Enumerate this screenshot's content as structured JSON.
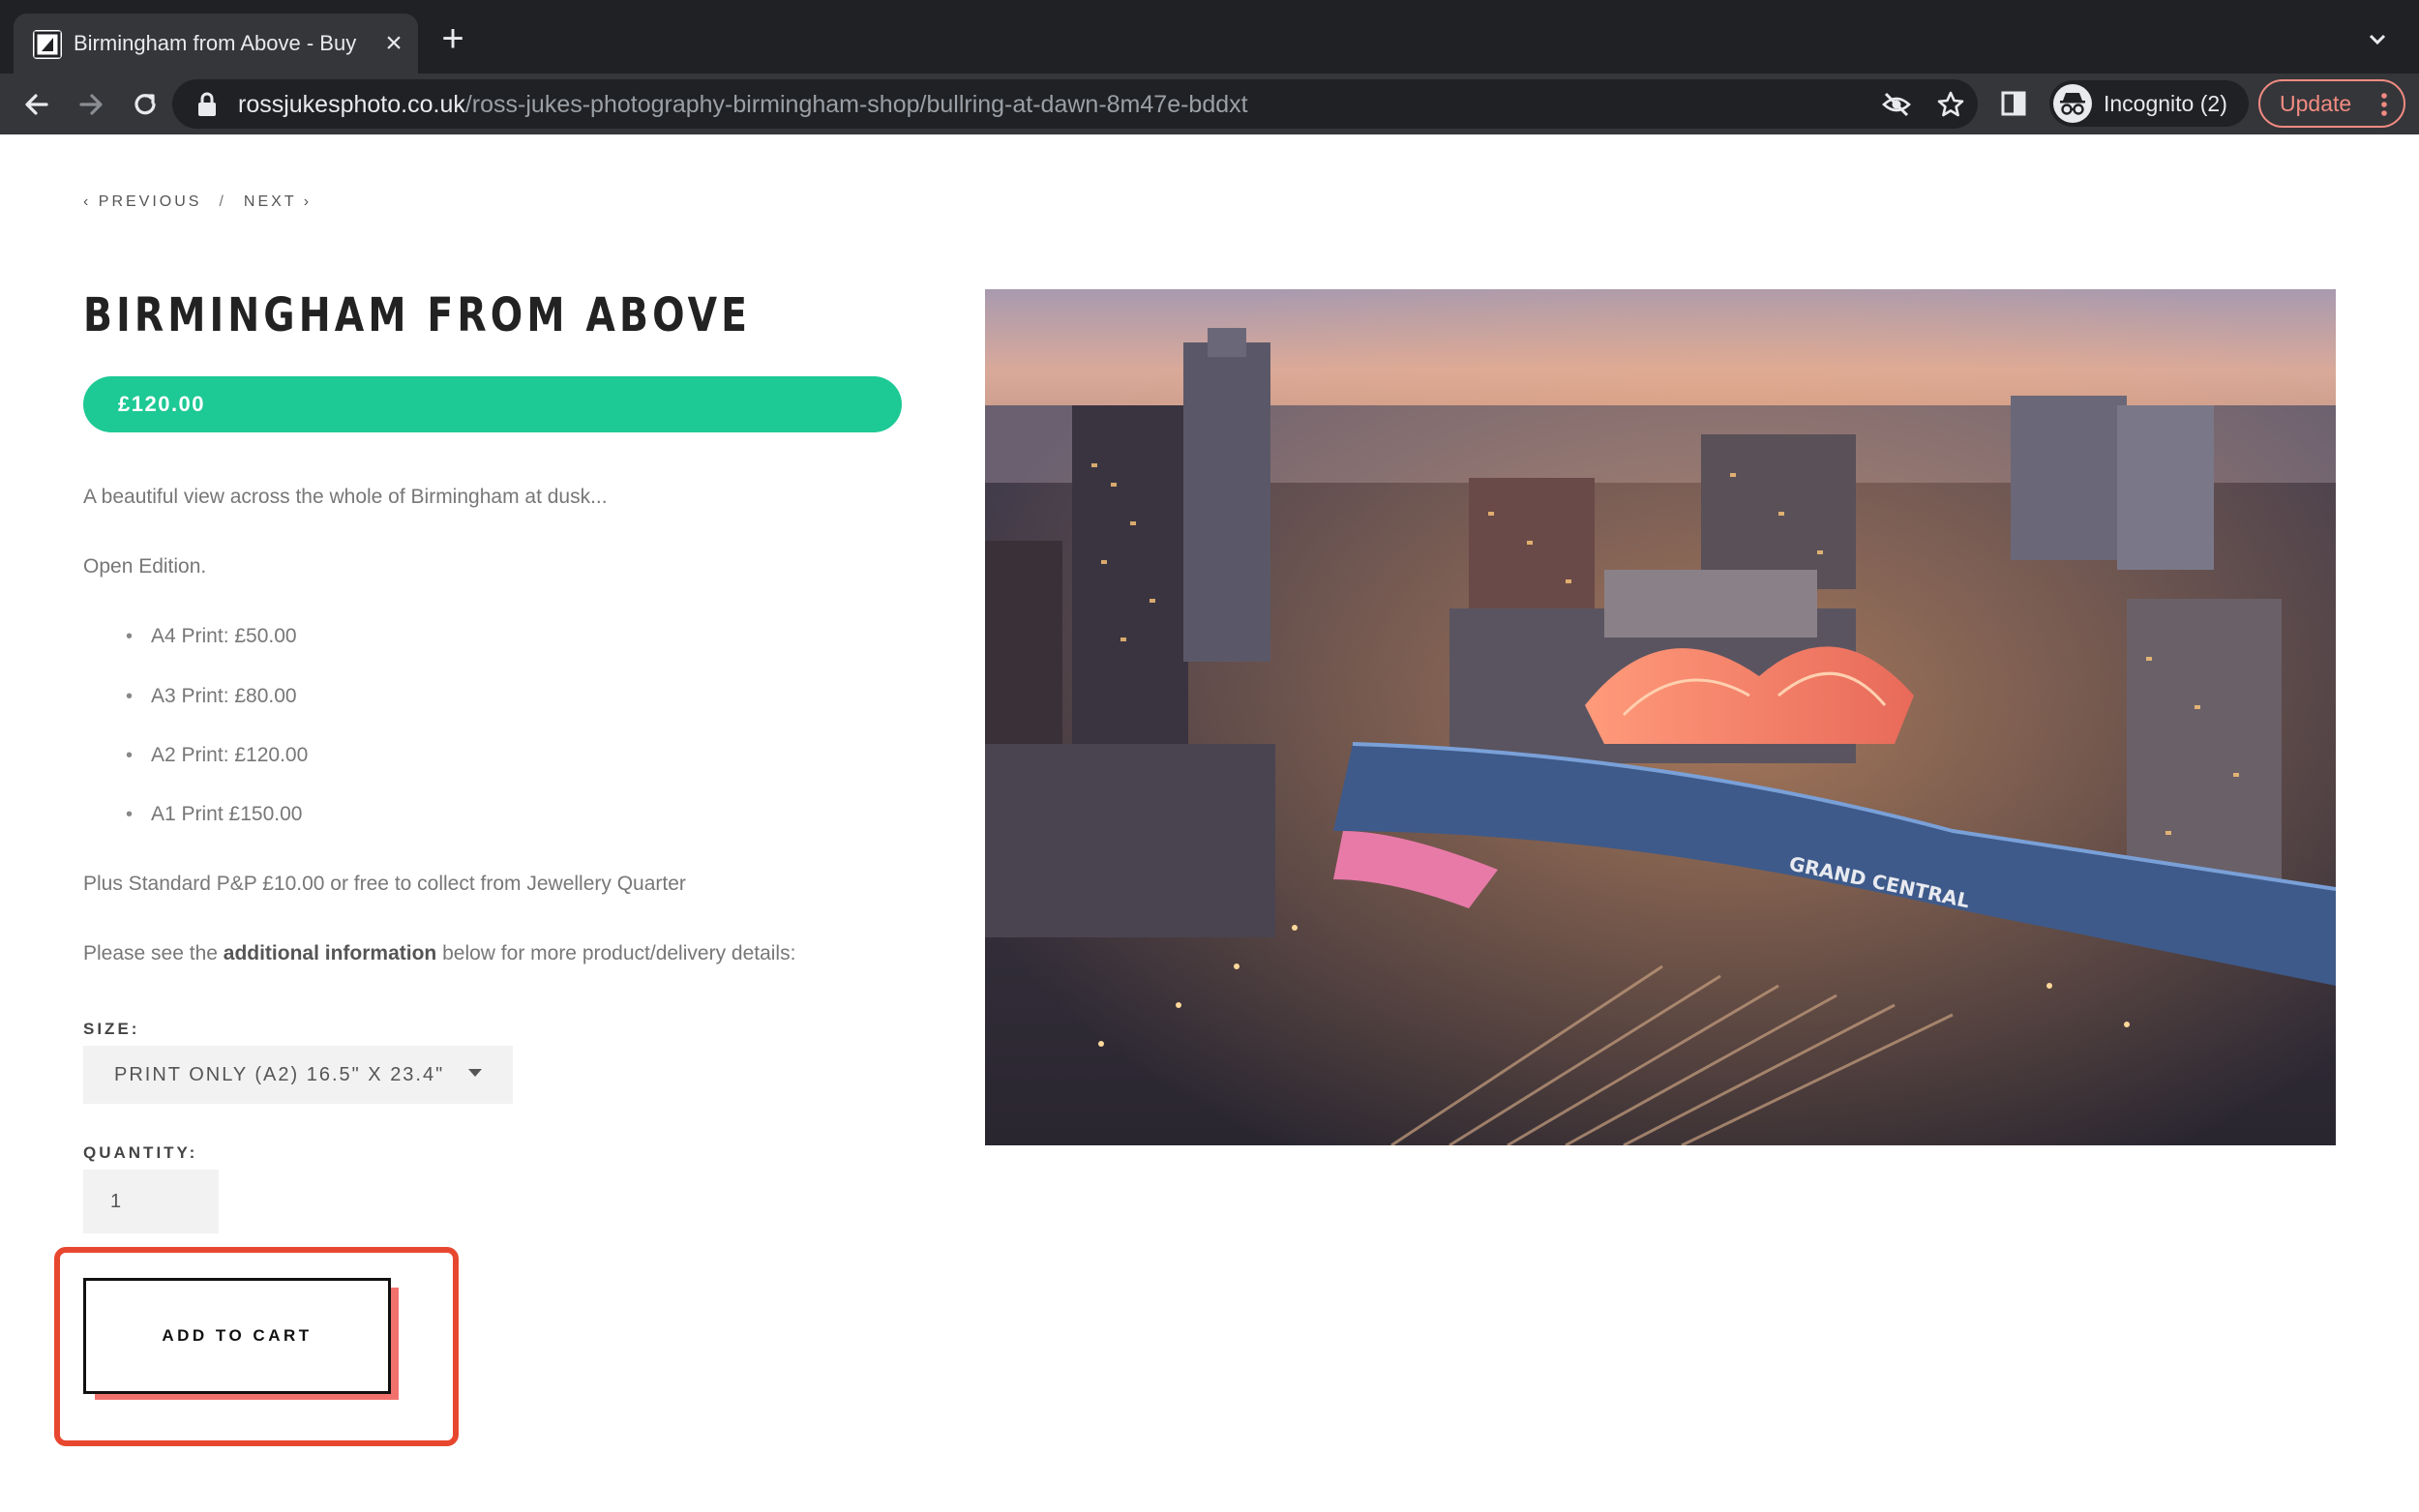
{
  "browser": {
    "tab": {
      "title": "Birmingham from Above - Buy",
      "close_icon": "close-icon",
      "favicon": "site-favicon"
    },
    "new_tab_icon": "plus-icon",
    "url": {
      "domain": "rossjukesphoto.co.uk",
      "path": "/ross-jukes-photography-birmingham-shop/bullring-at-dawn-8m47e-bddxt"
    },
    "incognito_label": "Incognito (2)",
    "update_label": "Update"
  },
  "pager": {
    "previous": "‹ PREVIOUS",
    "separator": "/",
    "next": "NEXT ›"
  },
  "product": {
    "title": "BIRMINGHAM FROM ABOVE",
    "price": "£120.00",
    "description": "A beautiful view across the whole of Birmingham at dusk...",
    "edition": "Open Edition.",
    "options": [
      "A4 Print: £50.00",
      "A3 Print: £80.00",
      "A2 Print: £120.00",
      "A1 Print £150.00"
    ],
    "shipping": "Plus Standard P&P £10.00 or free to collect from Jewellery Quarter",
    "info_prefix": "Please see the ",
    "info_bold": "additional information",
    "info_suffix": " below for more product/delivery details:"
  },
  "form": {
    "size_label": "SIZE:",
    "size_value": "PRINT ONLY (A2) 16.5\" X 23.4\"",
    "quantity_label": "QUANTITY:",
    "quantity_value": "1",
    "add_to_cart": "ADD TO CART"
  },
  "colors": {
    "price_bar": "#1dc994",
    "highlight": "#e8472f",
    "button_shadow": "#f2716d"
  }
}
